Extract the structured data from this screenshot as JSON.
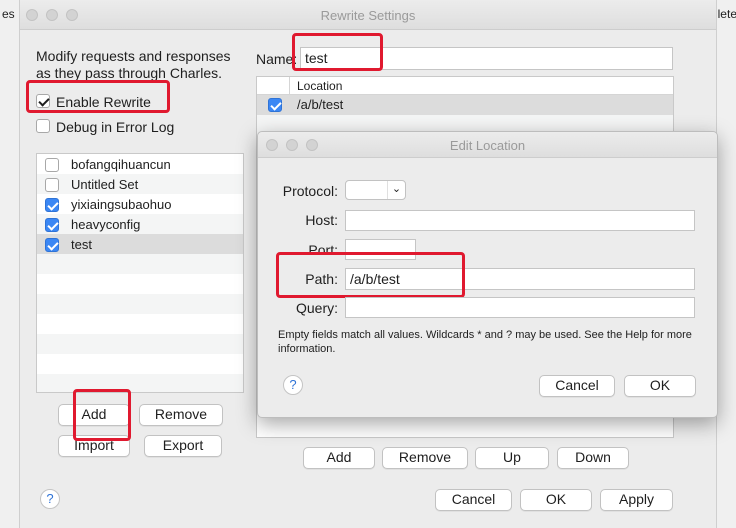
{
  "background": {
    "left_text": "es",
    "right_text": "lete"
  },
  "window": {
    "title": "Rewrite Settings",
    "description": "Modify requests and responses as they pass through Charles.",
    "description_line1": "Modify requests and responses",
    "description_line2": "as they pass through Charles.",
    "enable_rewrite": {
      "label": "Enable Rewrite",
      "checked": true
    },
    "debug_log": {
      "label": "Debug in Error Log",
      "checked": false
    },
    "sets": [
      {
        "label": "bofangqihuancun",
        "checked": false
      },
      {
        "label": "Untitled Set",
        "checked": false
      },
      {
        "label": "yixiaingsubaohuo",
        "checked": true
      },
      {
        "label": "heavyconfig",
        "checked": true
      },
      {
        "label": "test",
        "checked": true,
        "selected": true
      }
    ],
    "set_buttons": {
      "add": "Add",
      "remove": "Remove",
      "import": "Import",
      "export": "Export"
    },
    "name_label": "Name:",
    "name_value": "test",
    "location_header": "Location",
    "locations": [
      {
        "label": "/a/b/test",
        "checked": true
      }
    ],
    "location_buttons": {
      "add": "Add",
      "remove": "Remove",
      "up": "Up",
      "down": "Down"
    },
    "help": "?",
    "footer_buttons": {
      "cancel": "Cancel",
      "ok": "OK",
      "apply": "Apply"
    }
  },
  "edit_location": {
    "title": "Edit Location",
    "protocol_label": "Protocol:",
    "protocol_value": "",
    "host_label": "Host:",
    "host_value": "",
    "port_label": "Port:",
    "port_value": "",
    "path_label": "Path:",
    "path_value": "/a/b/test",
    "query_label": "Query:",
    "query_value": "",
    "hint_line1": "Empty fields match all values. Wildcards * and ? may be used. See the Help for more",
    "hint_line2": "information.",
    "help": "?",
    "cancel": "Cancel",
    "ok": "OK"
  },
  "colors": {
    "highlight": "#e0192f",
    "checkbox_on": "#3b87f4",
    "selection": "#dcdcdc"
  }
}
